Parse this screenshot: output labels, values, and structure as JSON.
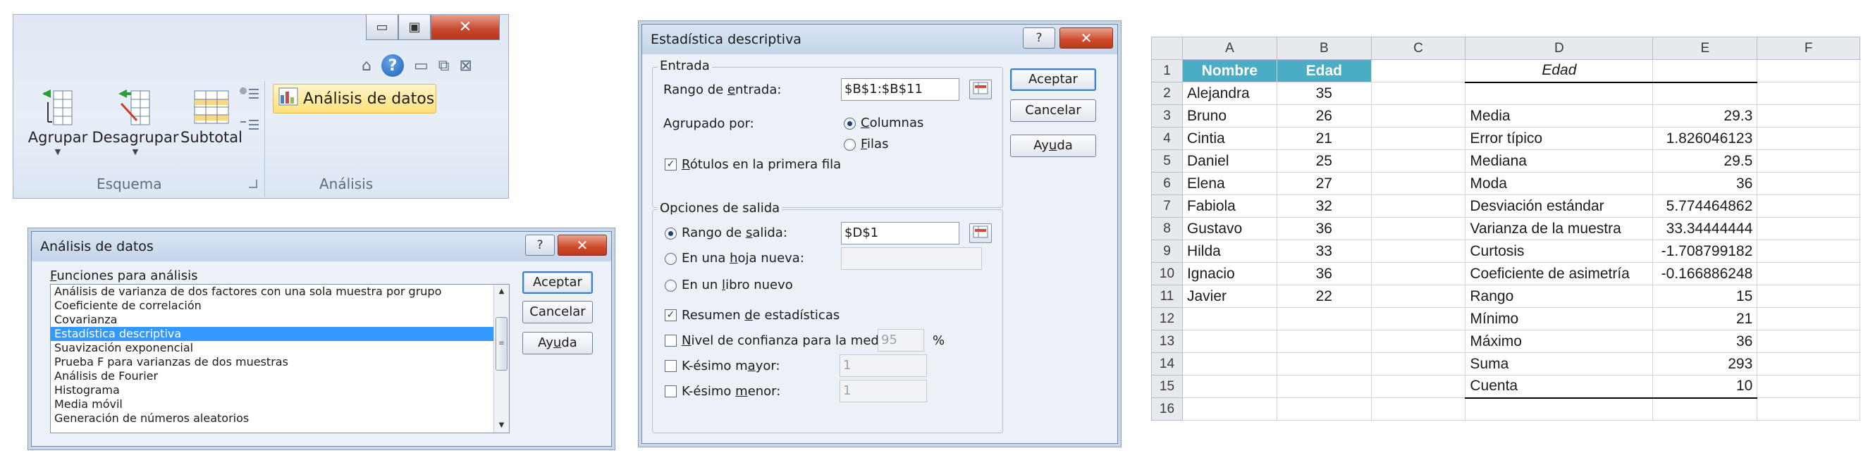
{
  "ribbon": {
    "buttons": {
      "agrupar": "Agrupar",
      "desagrupar": "Desagrupar",
      "subtotal": "Subtotal"
    },
    "groups": {
      "esquema": "Esquema",
      "analisis": "Análisis"
    },
    "analysis_button": "Análisis de datos",
    "window_controls": {
      "minimize": "▭",
      "restore": "▣",
      "close": "✕"
    },
    "mini": {
      "help": "?"
    }
  },
  "analisis_dialog": {
    "title": "Análisis de datos",
    "help": "?",
    "close": "✕",
    "section_label_prefix": "",
    "section_label_u": "F",
    "section_label_rest": "unciones para análisis",
    "items": [
      "Análisis de varianza de dos factores con una sola muestra por grupo",
      "Coeficiente de correlación",
      "Covarianza",
      "Estadística descriptiva",
      "Suavización exponencial",
      "Prueba F para varianzas de dos muestras",
      "Análisis de Fourier",
      "Histograma",
      "Media móvil",
      "Generación de números aleatorios"
    ],
    "selected_index": 3,
    "buttons": {
      "ok": "Aceptar",
      "cancel": "Cancelar",
      "help_prefix": "Ay",
      "help_u": "u",
      "help_rest": "da"
    }
  },
  "estadistica_dialog": {
    "title": "Estadística descriptiva",
    "help": "?",
    "close": "✕",
    "entrada": {
      "legend": "Entrada",
      "rango_label_prefix": "Rango de ",
      "rango_label_u": "e",
      "rango_label_rest": "ntrada:",
      "rango_value": "$B$1:$B$11",
      "agrupado_label": "Agrupado por:",
      "columnas_u": "C",
      "columnas_rest": "olumnas",
      "filas_u": "F",
      "filas_rest": "ilas",
      "rotulos_u": "R",
      "rotulos_rest": "ótulos en la primera fila",
      "rotulos_checked": "✓"
    },
    "salida": {
      "legend": "Opciones de salida",
      "rango_salida_prefix": "Rango de ",
      "rango_salida_u": "s",
      "rango_salida_rest": "alida:",
      "rango_salida_value": "$D$1",
      "hoja_prefix": "En una ",
      "hoja_u": "h",
      "hoja_rest": "oja nueva:",
      "libro_prefix": "En un ",
      "libro_u": "l",
      "libro_rest": "ibro nuevo",
      "resumen_prefix": "Resumen ",
      "resumen_u": "d",
      "resumen_rest": "e estadísticas",
      "resumen_checked": "✓",
      "nivel_u": "N",
      "nivel_rest": "ivel de confianza para la media:",
      "nivel_value": "95",
      "nivel_unit": "%",
      "mayor_prefix": "K-ésimo m",
      "mayor_u": "a",
      "mayor_rest": "yor:",
      "mayor_value": "1",
      "menor_prefix": "K-ésimo ",
      "menor_u": "m",
      "menor_rest": "enor:",
      "menor_value": "1"
    },
    "buttons": {
      "ok": "Aceptar",
      "cancel": "Cancelar",
      "help_prefix": "Ay",
      "help_u": "u",
      "help_rest": "da"
    }
  },
  "sheet": {
    "columns": [
      "A",
      "B",
      "C",
      "D",
      "E",
      "F"
    ],
    "rows": [
      {
        "n": "1",
        "a": "Nombre",
        "b": "Edad",
        "d": "Edad",
        "e": ""
      },
      {
        "n": "2",
        "a": "Alejandra",
        "b": "35",
        "d": "",
        "e": ""
      },
      {
        "n": "3",
        "a": "Bruno",
        "b": "26",
        "d": "Media",
        "e": "29.3"
      },
      {
        "n": "4",
        "a": "Cintia",
        "b": "21",
        "d": "Error típico",
        "e": "1.826046123"
      },
      {
        "n": "5",
        "a": "Daniel",
        "b": "25",
        "d": "Mediana",
        "e": "29.5"
      },
      {
        "n": "6",
        "a": "Elena",
        "b": "27",
        "d": "Moda",
        "e": "36"
      },
      {
        "n": "7",
        "a": "Fabiola",
        "b": "32",
        "d": "Desviación estándar",
        "e": "5.774464862"
      },
      {
        "n": "8",
        "a": "Gustavo",
        "b": "36",
        "d": "Varianza de la muestra",
        "e": "33.34444444"
      },
      {
        "n": "9",
        "a": "Hilda",
        "b": "33",
        "d": "Curtosis",
        "e": "-1.708799182"
      },
      {
        "n": "10",
        "a": "Ignacio",
        "b": "36",
        "d": "Coeficiente de asimetría",
        "e": "-0.166886248"
      },
      {
        "n": "11",
        "a": "Javier",
        "b": "22",
        "d": "Rango",
        "e": "15"
      },
      {
        "n": "12",
        "a": "",
        "b": "",
        "d": "Mínimo",
        "e": "21"
      },
      {
        "n": "13",
        "a": "",
        "b": "",
        "d": "Máximo",
        "e": "36"
      },
      {
        "n": "14",
        "a": "",
        "b": "",
        "d": "Suma",
        "e": "293"
      },
      {
        "n": "15",
        "a": "",
        "b": "",
        "d": "Cuenta",
        "e": "10"
      },
      {
        "n": "16",
        "a": "",
        "b": "",
        "d": "",
        "e": ""
      }
    ]
  },
  "colors": {
    "header_teal": "#4bacc6",
    "selection_blue": "#3399ff",
    "highlight_yellow": "#ffe07a",
    "close_red": "#cf4a2b"
  }
}
